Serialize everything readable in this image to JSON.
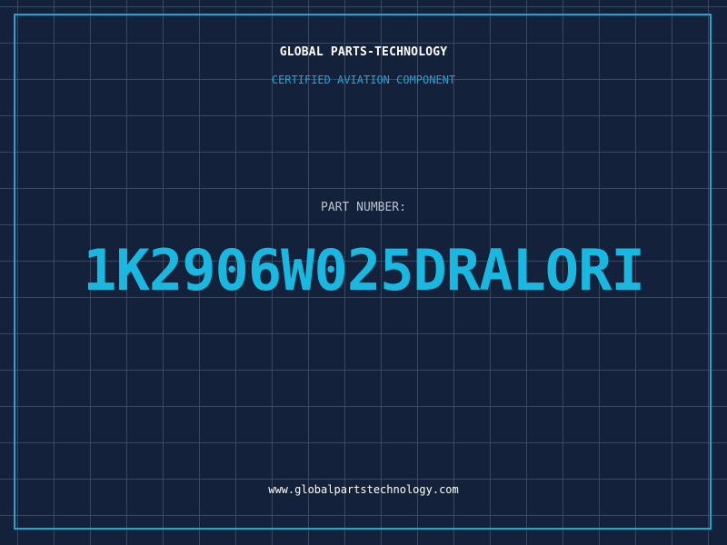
{
  "header": {
    "brand": "GLOBAL PARTS-TECHNOLOGY",
    "subtitle": "CERTIFIED AVIATION COMPONENT"
  },
  "part": {
    "label": "PART NUMBER:",
    "number": "1K2906W025DRALORI"
  },
  "footer": {
    "url": "www.globalpartstechnology.com"
  },
  "colors": {
    "background": "#13213a",
    "grid": "#287896",
    "accent": "#18b8e0",
    "frame": "#1aa8d0",
    "text": "#ffffff",
    "label": "#b9c2cc"
  }
}
